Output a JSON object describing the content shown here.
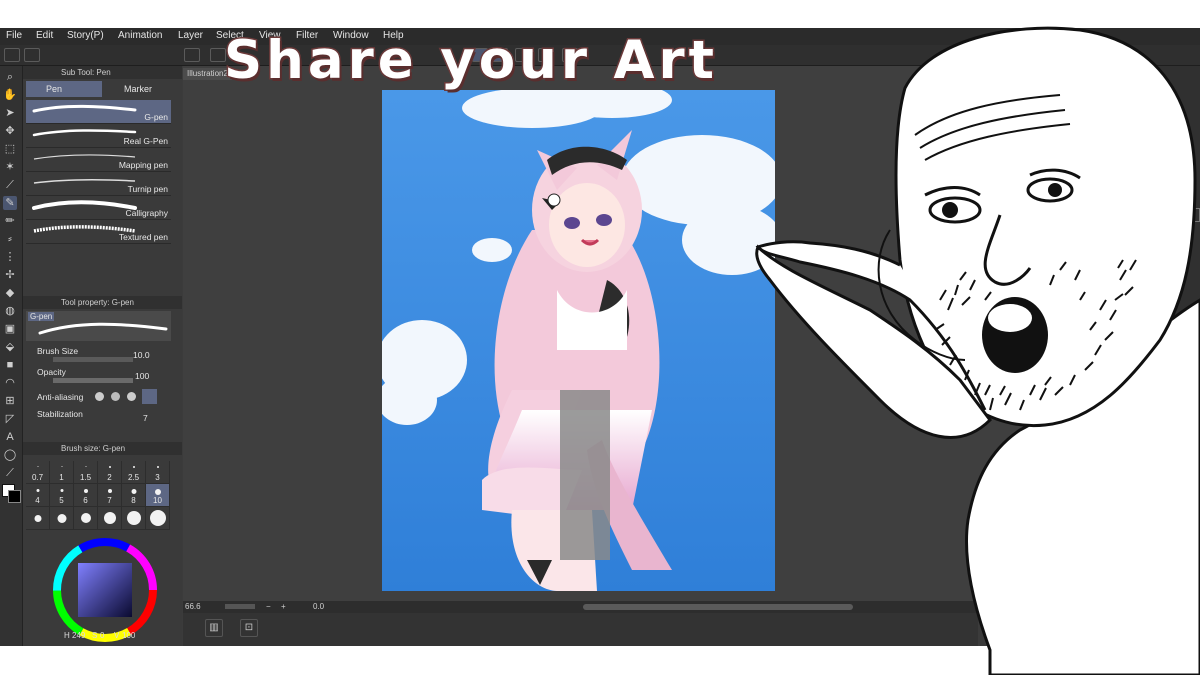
{
  "headline": "Share your Art",
  "menu": [
    "File",
    "Edit",
    "Story(P)",
    "Animation",
    "Layer",
    "Select",
    "View",
    "Filter",
    "Window",
    "Help"
  ],
  "document_tab": "Illustration2",
  "subtool_panel": {
    "title": "Sub Tool: Pen",
    "tabs": [
      "Pen",
      "Marker"
    ],
    "brushes": [
      "G-pen",
      "Real G-Pen",
      "Mapping pen",
      "Turnip pen",
      "Calligraphy",
      "Textured pen"
    ],
    "selected_index": 0
  },
  "tool_property": {
    "title": "Tool property: G-pen",
    "preview_label": "G-pen",
    "brush_size_label": "Brush Size",
    "brush_size_value": "10.0",
    "opacity_label": "Opacity",
    "opacity_value": "100",
    "anti_aliasing_label": "Anti-aliasing",
    "stabilization_label": "Stabilization",
    "stabilization_value": "7"
  },
  "brush_size_panel": {
    "title": "Brush size: G-pen",
    "sizes": [
      "0.7",
      "1",
      "1.5",
      "2",
      "2.5",
      "3",
      "4",
      "5",
      "6",
      "7",
      "8",
      "10"
    ],
    "selected": "10"
  },
  "color_readout": {
    "h": "249",
    "s": "0",
    "v": "100"
  },
  "status": {
    "zoom": "66.6",
    "angle": "0.0"
  },
  "colors": {
    "accent_selected": "#5d6784",
    "title_fill": "#ffffff",
    "title_outline": "#6b3a3a",
    "sky": "#4a98e8"
  }
}
